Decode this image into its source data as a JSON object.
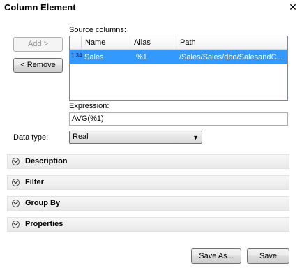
{
  "dialog": {
    "title": "Column Element",
    "close_glyph": "✕"
  },
  "buttons": {
    "add": "Add >",
    "remove": "< Remove",
    "save_as": "Save As...",
    "save": "Save"
  },
  "source": {
    "label": "Source columns:",
    "columns": [
      "Name",
      "Alias",
      "Path"
    ],
    "rows": [
      {
        "type_badge": "1.34",
        "name": "Sales",
        "alias": "%1",
        "path": "/Sales/Sales/dbo/SalesandC..."
      }
    ]
  },
  "expression": {
    "label": "Expression:",
    "value": "AVG(%1)"
  },
  "datatype": {
    "label": "Data type:",
    "value": "Real"
  },
  "sections": [
    {
      "title": "Description"
    },
    {
      "title": "Filter"
    },
    {
      "title": "Group By"
    },
    {
      "title": "Properties"
    }
  ],
  "colors": {
    "selection": "#3399ff",
    "border": "#828790"
  },
  "icons": {
    "close": "close-icon",
    "expand": "chevron-down-circle-icon",
    "dropdown": "dropdown-arrow-icon",
    "type": "numeric-type-icon"
  }
}
